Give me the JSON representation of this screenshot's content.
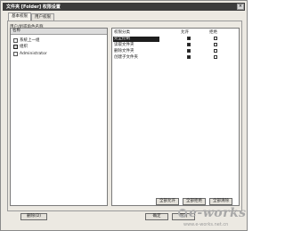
{
  "window": {
    "title": "文件夹 [Folder] 权限设置",
    "close_glyph": "×"
  },
  "tabs": [
    {
      "label": "基本权限"
    },
    {
      "label": "用户权限"
    }
  ],
  "left": {
    "group_title": "用户/组或角色名称",
    "header": "名称",
    "items": [
      {
        "label": "系统上一组"
      },
      {
        "label": "组织"
      },
      {
        "label": "Administrator"
      }
    ]
  },
  "right": {
    "col_perm": "权限分类",
    "col_allow": "允许",
    "col_deny": "拒绝",
    "rows": [
      {
        "name": "完全控制",
        "allow": true,
        "deny": false
      },
      {
        "name": "读取文件夹",
        "allow": true,
        "deny": false
      },
      {
        "name": "删除文件夹",
        "allow": true,
        "deny": false
      },
      {
        "name": "创建子文件夹",
        "allow": true,
        "deny": false
      }
    ]
  },
  "buttons": {
    "select_all": "全部允许",
    "deny_all": "全部拒绝",
    "clear_all": "全部清除",
    "delete": "删除(D)",
    "ok": "确定",
    "cancel": "取消"
  },
  "watermark": {
    "logo": "e-works",
    "domain": "www.e-works.net.cn"
  }
}
